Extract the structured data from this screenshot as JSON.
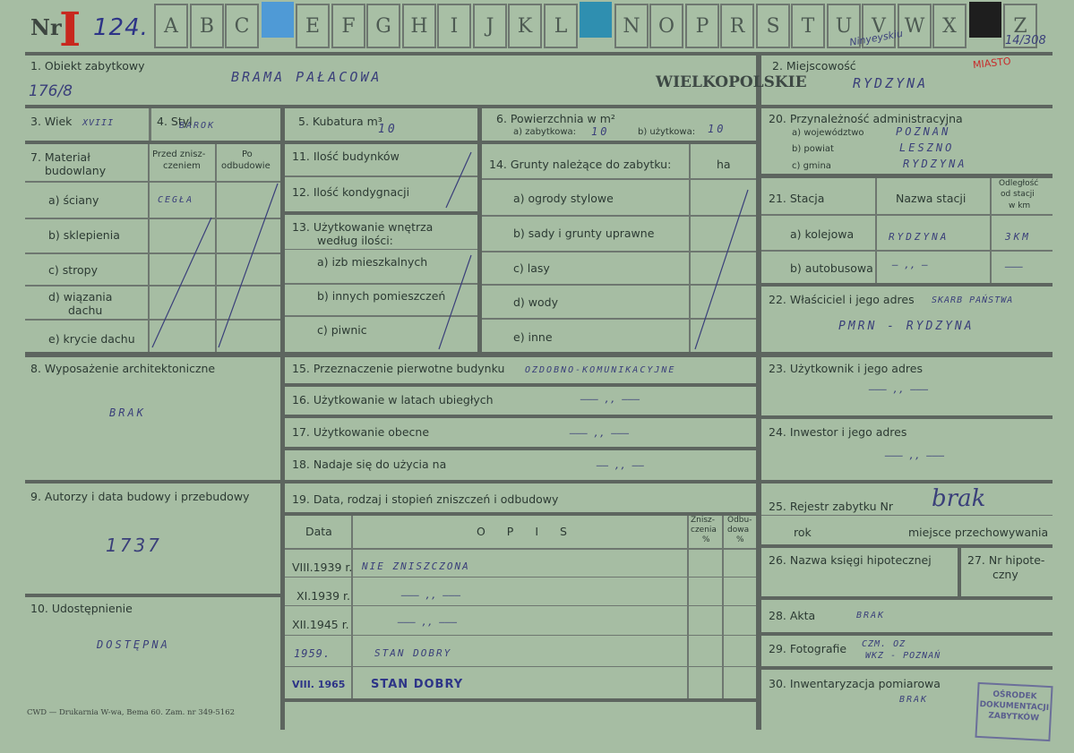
{
  "header": {
    "nr_label": "Nr",
    "roman": "I",
    "number": "124.",
    "letters": [
      "A",
      "B",
      "C",
      "",
      "E",
      "F",
      "G",
      "H",
      "I",
      "J",
      "K",
      "L",
      "",
      "N",
      "O",
      "P",
      "R",
      "S",
      "T",
      "U",
      "V",
      "W",
      "X",
      "",
      "Z"
    ],
    "tab_colors": {
      "D": "#4f9ad6",
      "M": "#2f8fb0",
      "Y": "#1e1e1e"
    },
    "top_right_note": "14/308",
    "signature_note": "Ninyeyskiu"
  },
  "fields": {
    "f1_label": "1. Obiekt zabytkowy",
    "f1_value": "BRAMA PAŁACOWA",
    "f1_side": "176/8",
    "province_stamp": "WIELKOPOLSKIE",
    "f2_label": "2. Miejscowość",
    "f2_value": "RYDZYNA",
    "f2_red": "MIASTO",
    "f3_label": "3. Wiek",
    "f3_value": "XVIII",
    "f4_label": "4. Styl",
    "f4_value": "BAROK",
    "f5_label": "5. Kubatura m³",
    "f5_value": "10",
    "f6_label": "6. Powierzchnia w m²",
    "f6_a_label": "a) zabytkowa:",
    "f6_a_value": "10",
    "f6_b_label": "b) użytkowa:",
    "f6_b_value": "10",
    "f20_label": "20. Przynależność administracyjna",
    "f20_a_label": "a) województwo",
    "f20_a_value": "POZNAŃ",
    "f20_b_label": "b) powiat",
    "f20_b_value": "LESZNO",
    "f20_c_label": "c) gmina",
    "f20_c_value": "RYDZYNA",
    "f7_label_1": "7. Materiał",
    "f7_label_2": "budowlany",
    "f7_col1_1": "Przed znisz-",
    "f7_col1_2": "czeniem",
    "f7_col2_1": "Po",
    "f7_col2_2": "odbudowie",
    "f7_rows": [
      "a) ściany",
      "b) sklepienia",
      "c) stropy",
      "d) wiązania",
      "e) krycie dachu"
    ],
    "f7_row_d2": "dachu",
    "f7_a_value": "CEGŁA",
    "f11_label": "11. Ilość budynków",
    "f12_label": "12. Ilość kondygnacji",
    "f13_label_1": "13. Użytkowanie wnętrza",
    "f13_label_2": "według ilości:",
    "f13_a": "a) izb mieszkalnych",
    "f13_b": "b) innych pomieszczeń",
    "f13_c": "c) piwnic",
    "f14_label": "14. Grunty należące do zabytku:",
    "f14_unit": "ha",
    "f14_rows": [
      "a) ogrody stylowe",
      "b) sady i grunty uprawne",
      "c) lasy",
      "d) wody",
      "e) inne"
    ],
    "f21_label": "21. Stacja",
    "f21_col_name": "Nazwa stacji",
    "f21_col_dist_1": "Odległość",
    "f21_col_dist_2": "od stacji",
    "f21_col_dist_3": "w km",
    "f21_a": "a) kolejowa",
    "f21_a_name": "RYDZYNA",
    "f21_a_dist": "3KM",
    "f21_b": "b) autobusowa",
    "f21_b_name": "— ,, —",
    "f21_b_dist": "———",
    "f22_label": "22. Właściciel i jego adres",
    "f22_value_1": "SKARB PAŃSTWA",
    "f22_value_2": "PMRN - RYDZYNA",
    "f8_label": "8. Wyposażenie architektoniczne",
    "f8_value": "BRAK",
    "f15_label": "15. Przeznaczenie pierwotne budynku",
    "f15_value": "OZDOBNO-KOMUNIKACYJNE",
    "f16_label": "16. Użytkowanie w latach ubiegłych",
    "f16_value": "——— ,, ———",
    "f17_label": "17. Użytkowanie obecne",
    "f17_value": "——— ,, ———",
    "f18_label": "18. Nadaje się do użycia na",
    "f18_value": "—— ,, ——",
    "f23_label": "23. Użytkownik i jego adres",
    "f23_value": "——— ,, ———",
    "f24_label": "24. Inwestor i jego adres",
    "f24_value": "——— ,, ———",
    "f9_label": "9. Autorzy i data budowy i przebudowy",
    "f9_value": "1737",
    "f19_label": "19. Data, rodzaj i stopień zniszczeń i odbudowy",
    "f19_col_date": "Data",
    "f19_col_opis": "O P I S",
    "f19_col_znis_1": "Znisz-",
    "f19_col_znis_2": "czenia",
    "f19_col_odb_1": "Odbu-",
    "f19_col_odb_2": "dowa",
    "f19_pct": "%",
    "f19_rows": [
      {
        "date": "VIII.1939 r.",
        "opis": "NIE ZNISZCZONA"
      },
      {
        "date": "XI.1939 r.",
        "opis": "——— ,, ———"
      },
      {
        "date": "XII.1945 r.",
        "opis": "——— ,, ———"
      },
      {
        "date": "1959.",
        "opis": "STAN DOBRY"
      },
      {
        "date": "VIII. 1965",
        "opis": "STAN DOBRY"
      }
    ],
    "f25_label": "25. Rejestr zabytku Nr",
    "f25_value": "brak",
    "f25_rok": "rok",
    "f25_miejsce": "miejsce przechowywania",
    "f26_label": "26. Nazwa księgi hipotecznej",
    "f27_label_1": "27. Nr hipote-",
    "f27_label_2": "czny",
    "f10_label": "10. Udostępnienie",
    "f10_value": "DOSTĘPNA",
    "f28_label": "28. Akta",
    "f28_value": "BRAK",
    "f29_label": "29. Fotografie",
    "f29_value_1": "CZM. OZ",
    "f29_value_2": "WKZ - POZNAŃ",
    "f30_label": "30. Inwentaryzacja pomiarowa",
    "f30_value": "BRAK",
    "printer": "CWD — Drukarnia W-wa, Bema 60. Zam. nr 349-5162",
    "stamp_1": "OŚRODEK",
    "stamp_2": "DOKUMENTACJI",
    "stamp_3": "ZABYTKÓW"
  }
}
